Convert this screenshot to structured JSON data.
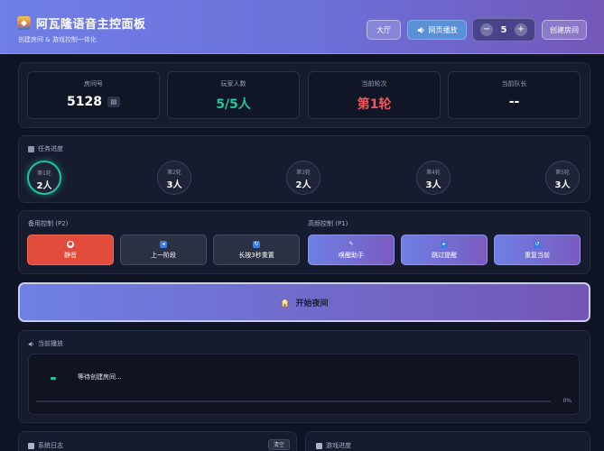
{
  "header": {
    "title": "阿瓦隆语音主控面板",
    "subtitle": "创建房间 & 游戏控制一体化",
    "app_icon": "mask-icon",
    "lobby_label": "大厅",
    "web_play_label": "网页播放",
    "player_count": "5",
    "decrement": "−",
    "increment": "+",
    "create_room_label": "创建房间"
  },
  "info": {
    "room_label": "房间号",
    "room_value": "5128",
    "players_label": "玩家人数",
    "players_value": "5/5人",
    "round_label": "当前轮次",
    "round_value": "第1轮",
    "captain_label": "当前队长",
    "captain_value": "--"
  },
  "missions": {
    "label": "任务进度",
    "rounds": [
      {
        "label": "第1轮",
        "count": "2人",
        "active": true
      },
      {
        "label": "第2轮",
        "count": "3人",
        "active": false
      },
      {
        "label": "第3轮",
        "count": "2人",
        "active": false
      },
      {
        "label": "第4轮",
        "count": "3人",
        "active": false
      },
      {
        "label": "第5轮",
        "count": "3人",
        "active": false
      }
    ]
  },
  "controls": {
    "backup_label": "备用控制 (P2)",
    "frequent_label": "高频控制 (P1)",
    "mute": "静音",
    "prev_phase": "上一阶段",
    "long_press_reset": "长按3秒重置",
    "wake_helper": "唤醒助手",
    "skip_prompt": "跳过提醒",
    "repeat_current": "重复当前"
  },
  "start": {
    "label": "开始夜间"
  },
  "playback": {
    "label": "当前播放",
    "status": "等待创建房间...",
    "progress": 0,
    "progress_text": "0%"
  },
  "log": {
    "label": "系统日志",
    "clear": "清空"
  },
  "progress_panel": {
    "label": "游戏进度"
  },
  "colors": {
    "accent": "#6f80e4",
    "success": "#1cc6a0",
    "danger": "#e14b3b",
    "round_value": "#f0565a"
  }
}
